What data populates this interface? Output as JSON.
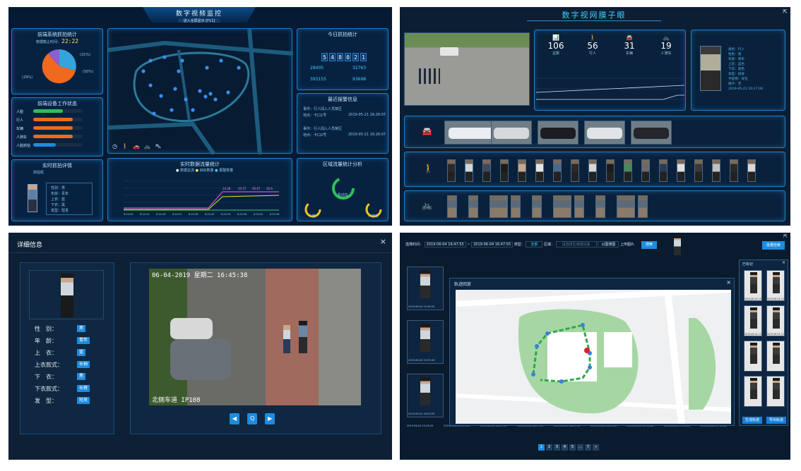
{
  "q1": {
    "title": "数字视频监控",
    "subtitle": "进入全屏显示 [F11]",
    "p_capture": {
      "title": "前端系统抓拍统计",
      "time_label": "数据截止时间：",
      "time": "22:22",
      "legend": [
        "(21%)",
        "(50%)",
        "(29%)"
      ]
    },
    "p_device": {
      "title": "前端设备工作状态",
      "rows": [
        {
          "label": "人脸",
          "pct": 0.6,
          "color": "#2fbf5a"
        },
        {
          "label": "行人",
          "pct": 0.8,
          "color": "#ee6a1a"
        },
        {
          "label": "车辆",
          "pct": 0.8,
          "color": "#ee6a1a"
        },
        {
          "label": "人骑车",
          "pct": 0.8,
          "color": "#ee6a1a"
        },
        {
          "label": "人脸抓拍",
          "pct": 0.45,
          "color": "#1d8ce0"
        }
      ]
    },
    "p_realtime": {
      "title": "实时抓拍详情",
      "device": "抓拍机",
      "attrs": [
        "性别：男",
        "年龄：青年",
        "上衣：蓝",
        "下衣：黑",
        "发型：短发"
      ]
    },
    "p_today": {
      "title": "今日抓拍统计",
      "digits": [
        "5",
        "4",
        "8",
        "0",
        "2",
        "1"
      ],
      "stats": [
        "28405",
        "32763",
        "393155",
        "93698"
      ]
    },
    "p_alarm": {
      "title": "最近报警信息",
      "items": [
        "事件：行人闯入人员禁区",
        "地点：卡口1号",
        "事件：行人闯入人员禁区",
        "地点：卡口2号"
      ],
      "times": [
        "2019-05-21 16:26:07",
        "2019-05-21 16:26:07"
      ]
    },
    "p_trend": {
      "title": "实时数据流量统计",
      "legend": [
        "数据总流",
        "目标数量",
        "报警数量"
      ],
      "values": [
        "14.28",
        "20.57",
        "26.67",
        "26.6"
      ],
      "xticks": [
        "6:20:00",
        "6:20:14",
        "6:20:18",
        "6:20:22",
        "6:20:26",
        "6:20:30",
        "6:20:34",
        "6:20:38",
        "6:20:42",
        "6:20:46"
      ]
    },
    "p_gauge": {
      "title": "区域流量统计分析",
      "labels": [
        "人脸",
        "机动车",
        "人骑车"
      ]
    }
  },
  "q2": {
    "title": "数字视网膜子眼",
    "counts": [
      {
        "value": "106",
        "label": "总数"
      },
      {
        "value": "56",
        "label": "行人"
      },
      {
        "value": "31",
        "label": "车辆"
      },
      {
        "value": "19",
        "label": "人骑车"
      }
    ],
    "detail": [
      "类别：行人",
      "性别：男",
      "年龄：青年",
      "上衣：蓝色",
      "下衣：黑色",
      "发型：短发",
      "手提物：背包",
      "帽子：无",
      "2019-05-21 16:17:09"
    ],
    "vehicle_colors": [
      "#e8eef2",
      "#d6d9dc",
      "#1b1d22",
      "#dfe4e6",
      "#24262b"
    ],
    "ped_count": 18,
    "bike_count": 10
  },
  "q3": {
    "title": "详细信息",
    "close": "×",
    "attrs": [
      {
        "key": "性　别：",
        "val": "男"
      },
      {
        "key": "年　龄：",
        "val": "青年"
      },
      {
        "key": "上　衣：",
        "val": "蓝"
      },
      {
        "key": "上衣款式：",
        "val": "长袖"
      },
      {
        "key": "下　衣：",
        "val": "黑"
      },
      {
        "key": "下衣款式：",
        "val": "长裤"
      },
      {
        "key": "发　型：",
        "val": "短发"
      }
    ],
    "osd_time": "06-04-2019 星期二 16:45:38",
    "osd_place": "北侧车道 IP108",
    "controls": [
      "◀",
      "Q",
      "▶"
    ]
  },
  "q4": {
    "search": {
      "time_label": "选择时间：",
      "time_start": "2019-06-04 16:47:55",
      "time_end": "2019-06-04 16:47:55",
      "type_label": "类型：",
      "type_val": "全部",
      "area_label": "区域：",
      "area_ph": "请选择区域或设备",
      "btn1": "以图搜图",
      "upload": "上传图片",
      "search_btn": "搜索",
      "right_btn": "批量检索"
    },
    "dialog_title": "轨迹回放",
    "side_title": "已标记",
    "side_buttons": [
      "生成轨迹",
      "导出轨迹"
    ],
    "pages": [
      "1",
      "2",
      "3",
      "4",
      "5",
      "…",
      "7",
      "»"
    ],
    "row_times": [
      "2019-06-04 15:45:20",
      "2019-06-04 15:53:49",
      "2019-06-04 16:03:50",
      "2019-06-04 16:17:29",
      "2019-06-04 16:27:50",
      "2019-06-04 16:49:30",
      "2019-06-04 16:58:08",
      "2019-06-04 17:06:16",
      "2019-06-04 17:10:20"
    ],
    "side_times": [
      "2019-06-04 15:46:49",
      "2019-06-04 15:48:40",
      "2019-06-04 15:52:08",
      "2019-06-04 15:57:55"
    ]
  }
}
